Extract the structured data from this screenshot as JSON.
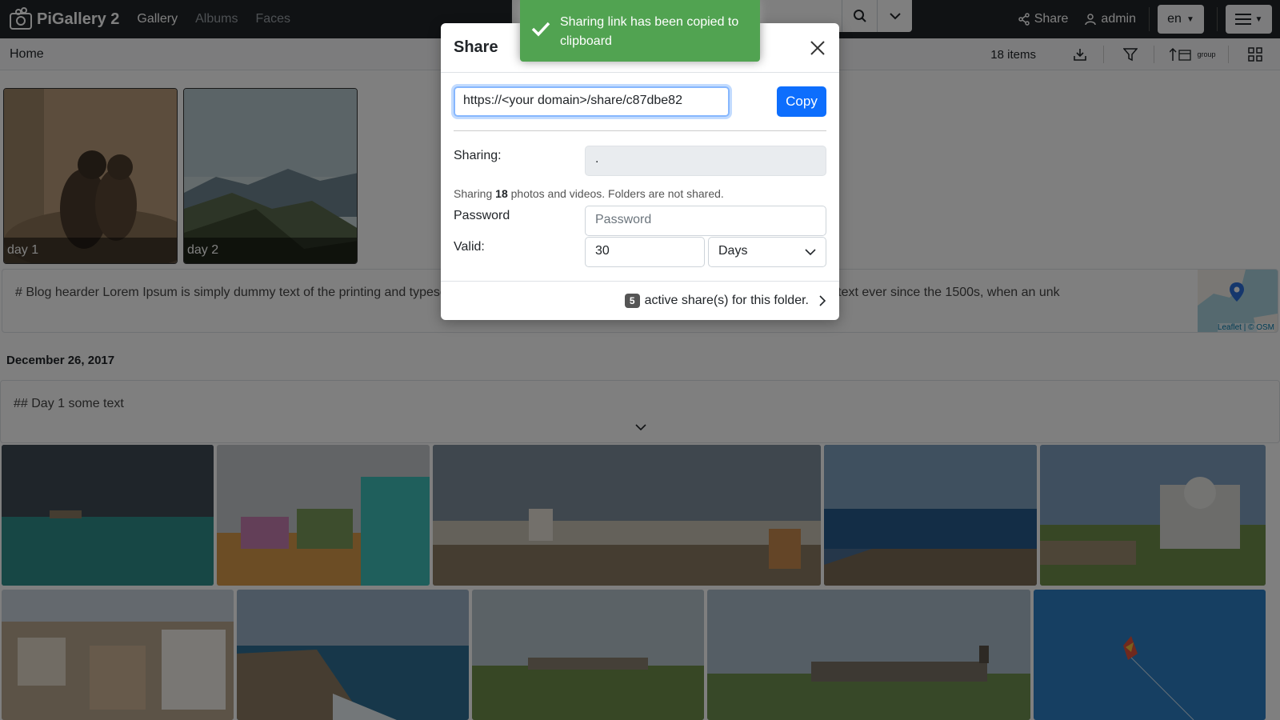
{
  "navbar": {
    "brand": "PiGallery 2",
    "links": [
      "Gallery",
      "Albums",
      "Faces"
    ],
    "share_label": "Share",
    "user_label": "admin",
    "language": "en"
  },
  "subheader": {
    "breadcrumb": "Home",
    "item_count": "18 items",
    "group_label": "group"
  },
  "albums": [
    {
      "label": "day 1"
    },
    {
      "label": "day 2"
    }
  ],
  "blog": {
    "text": "# Blog hearder Lorem Ipsum is simply dummy text of the printing and typesetting industry. Lorem Ipsum has been the industry's standard dummy text ever since the 1500s, when an unk",
    "map_attribution": "Leaflet | © OSM"
  },
  "date_heading": "December 26, 2017",
  "day_block_text": "## Day 1 some text",
  "modal": {
    "title": "Share",
    "url": "https://<your domain>/share/c87dbe82",
    "copy_label": "Copy",
    "sharing_label": "Sharing:",
    "sharing_value": ".",
    "note_prefix": "Sharing",
    "note_count": "18",
    "note_suffix": "photos and videos. Folders are not shared.",
    "password_label": "Password",
    "password_placeholder": "Password",
    "valid_label": "Valid:",
    "valid_amount": "30",
    "valid_unit": "Days",
    "active_count": "5",
    "active_text": "active share(s) for this folder."
  },
  "toast": {
    "message": "Sharing link has been copied to clipboard"
  },
  "colors": {
    "navbar": "#212529",
    "primary": "#0d6efd",
    "toast": "#51a351"
  }
}
